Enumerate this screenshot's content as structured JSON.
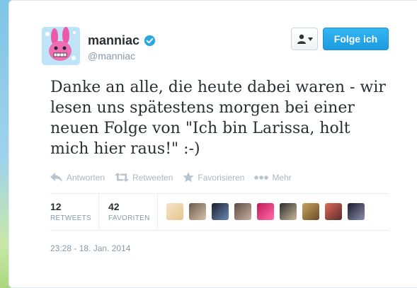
{
  "user": {
    "display_name": "manniac",
    "handle": "@manniac",
    "verified": true
  },
  "buttons": {
    "user_menu_icon": "user-dropdown-icon",
    "follow_label": "Folge ich"
  },
  "tweet": {
    "text": "Danke an alle, die heute dabei waren - wir lesen uns spätestens morgen bei einer neuen Folge von \"Ich bin Larissa, holt mich hier raus!\" :-)"
  },
  "actions": [
    {
      "label": "Antworten",
      "icon": "reply-icon"
    },
    {
      "label": "Retweeten",
      "icon": "retweet-icon"
    },
    {
      "label": "Favorisieren",
      "icon": "star-icon"
    },
    {
      "label": "Mehr",
      "icon": "more-icon"
    }
  ],
  "stats": {
    "retweets": {
      "count": "12",
      "label": "RETWEETS"
    },
    "favorites": {
      "count": "42",
      "label": "FAVORITEN"
    }
  },
  "timestamp": "23:28 - 18. Jan. 2014",
  "colors": {
    "accent": "#1c9ae0",
    "text": "#292f33",
    "muted": "#8899a6",
    "action": "#aab8c2"
  }
}
